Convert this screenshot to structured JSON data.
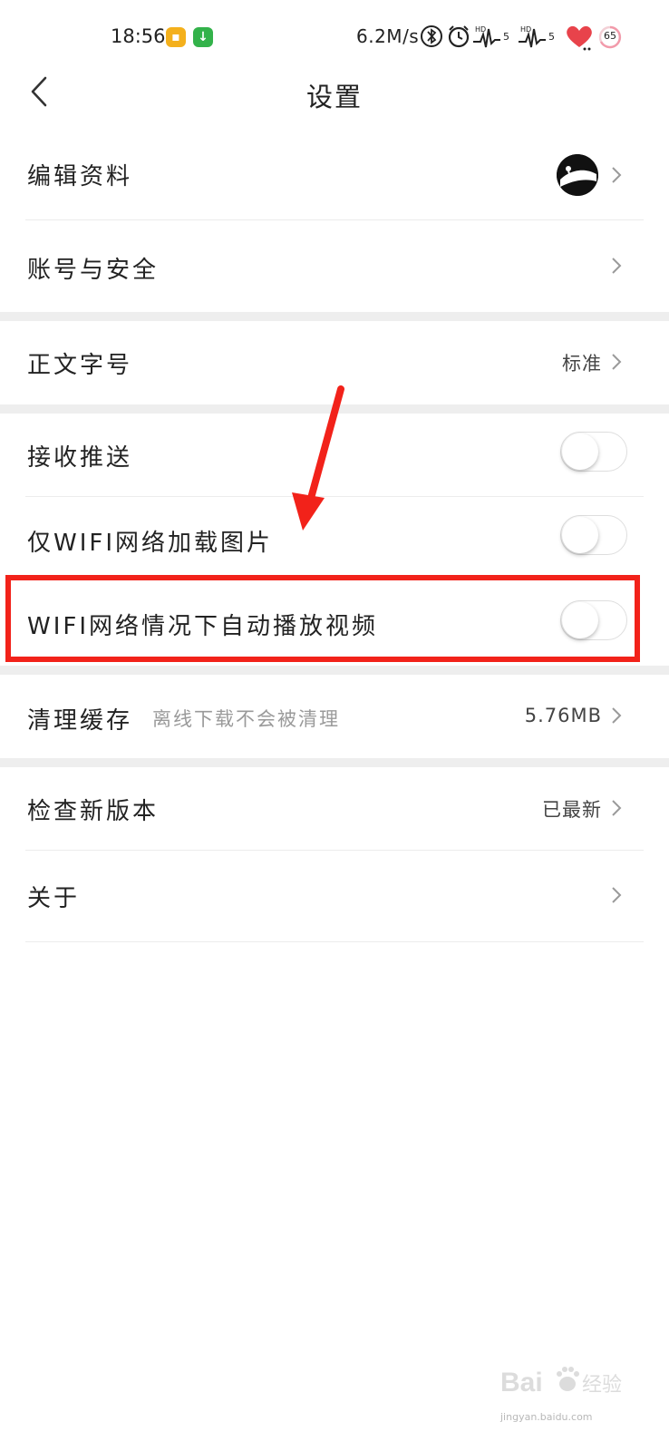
{
  "status_bar": {
    "time": "18:56",
    "net_speed": "6.2M/s",
    "battery": "65",
    "icons": [
      "app-notification-icon",
      "download-icon",
      "bluetooth-icon",
      "alarm-icon",
      "hd-signal-icon",
      "hd-signal-icon",
      "heart-icon",
      "battery-icon"
    ]
  },
  "header": {
    "title": "设置",
    "back_icon": "back-chevron-icon"
  },
  "settings": {
    "edit_profile": {
      "label": "编辑资料"
    },
    "account_security": {
      "label": "账号与安全"
    },
    "font_size": {
      "label": "正文字号",
      "value": "标准"
    },
    "receive_push": {
      "label": "接收推送",
      "enabled": false
    },
    "wifi_only_images": {
      "label": "仅WIFI网络加载图片",
      "enabled": false
    },
    "wifi_autoplay": {
      "label": "WIFI网络情况下自动播放视频",
      "enabled": false
    },
    "clear_cache": {
      "label": "清理缓存",
      "hint": "离线下载不会被清理",
      "value": "5.76MB"
    },
    "check_update": {
      "label": "检查新版本",
      "value": "已最新"
    },
    "about": {
      "label": "关于"
    }
  },
  "annotation": {
    "highlight_color": "#f2221a"
  },
  "watermark": {
    "brand": "Bai",
    "brand2": "du",
    "text": "经验",
    "url": "jingyan.baidu.com"
  },
  "colors": {
    "accent_red": "#f2221a",
    "separator": "#eeeeee"
  }
}
